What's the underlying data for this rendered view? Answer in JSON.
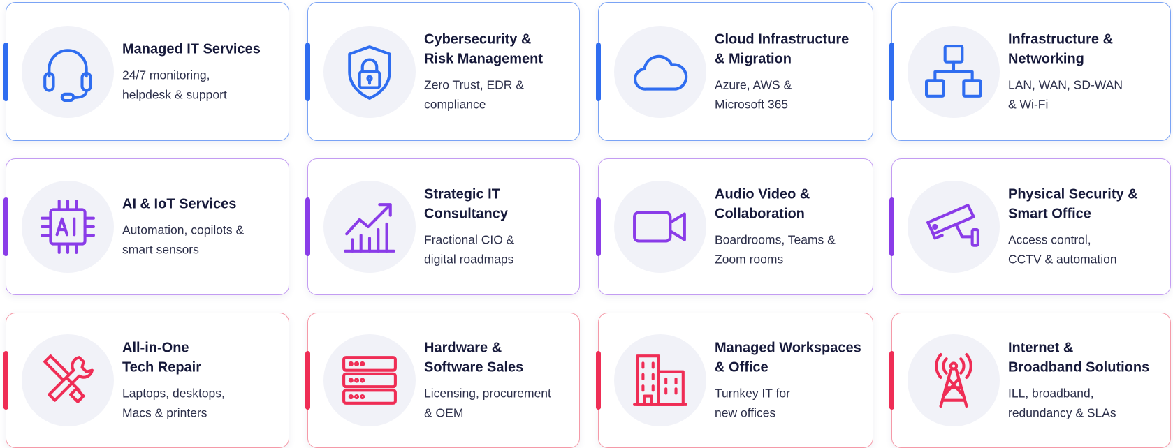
{
  "colors": {
    "blue": "#2f6df0",
    "purple": "#8a3ce8",
    "red": "#ef2d55",
    "icon_background": "#f1f2f8"
  },
  "services": [
    {
      "title": "Managed IT Services",
      "description": "24/7 monitoring,\nhelpdesk & support",
      "icon": "headset-icon"
    },
    {
      "title": "Cybersecurity &\nRisk Management",
      "description": "Zero Trust, EDR &\ncompliance",
      "icon": "shield-lock-icon"
    },
    {
      "title": "Cloud Infrastructure\n& Migration",
      "description": "Azure, AWS &\nMicrosoft 365",
      "icon": "cloud-icon"
    },
    {
      "title": "Infrastructure &\nNetworking",
      "description": "LAN, WAN, SD-WAN\n& Wi-Fi",
      "icon": "network-icon"
    },
    {
      "title": "AI & IoT Services",
      "description": "Automation, copilots &\nsmart sensors",
      "icon": "ai-chip-icon"
    },
    {
      "title": "Strategic IT\nConsultancy",
      "description": "Fractional CIO &\ndigital roadmaps",
      "icon": "growth-chart-icon"
    },
    {
      "title": "Audio Video &\nCollaboration",
      "description": "Boardrooms, Teams &\nZoom rooms",
      "icon": "video-camera-icon"
    },
    {
      "title": "Physical Security &\nSmart Office",
      "description": "Access control,\nCCTV & automation",
      "icon": "cctv-camera-icon"
    },
    {
      "title": "All-in-One\nTech Repair",
      "description": "Laptops, desktops,\nMacs & printers",
      "icon": "tools-icon"
    },
    {
      "title": "Hardware &\nSoftware Sales",
      "description": "Licensing, procurement\n& OEM",
      "icon": "server-icon"
    },
    {
      "title": "Managed Workspaces\n& Office",
      "description": "Turnkey IT for\nnew offices",
      "icon": "office-building-icon"
    },
    {
      "title": "Internet &\nBroadband Solutions",
      "description": "ILL, broadband,\nredundancy & SLAs",
      "icon": "radio-tower-icon"
    }
  ]
}
